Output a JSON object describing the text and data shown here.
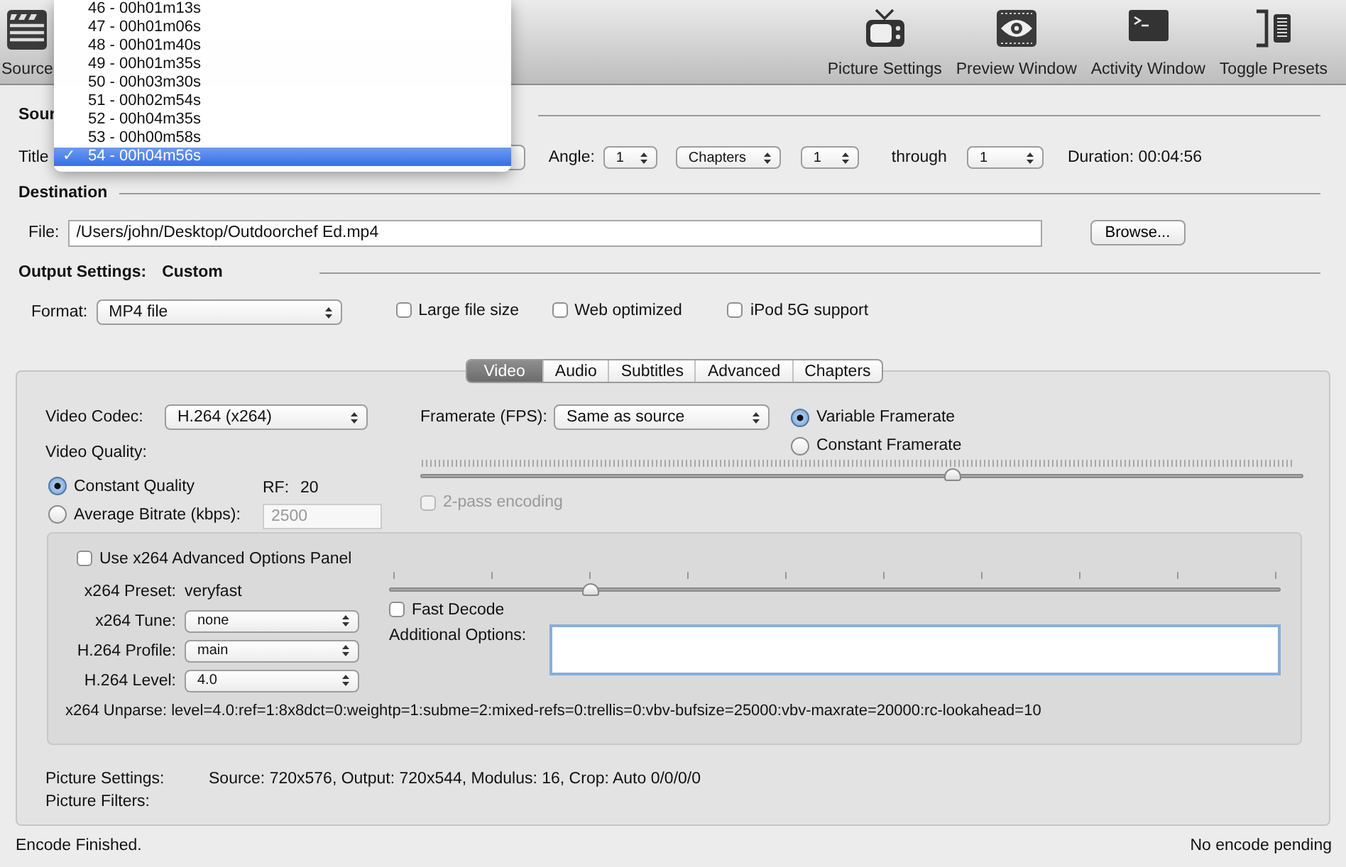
{
  "toolbar": {
    "left": [
      {
        "label": "Source",
        "kind": "clapper"
      }
    ],
    "right": [
      {
        "label": "Picture Settings",
        "kind": "tv"
      },
      {
        "label": "Preview Window",
        "kind": "eye"
      },
      {
        "label": "Activity Window",
        "kind": "terminal"
      },
      {
        "label": "Toggle Presets",
        "kind": "drawer"
      }
    ]
  },
  "title_menu": {
    "items": [
      {
        "label": "46 - 00h01m13s",
        "selected": false
      },
      {
        "label": "47 - 00h01m06s",
        "selected": false
      },
      {
        "label": "48 - 00h01m40s",
        "selected": false
      },
      {
        "label": "49 - 00h01m35s",
        "selected": false
      },
      {
        "label": "50 - 00h03m30s",
        "selected": false
      },
      {
        "label": "51 - 00h02m54s",
        "selected": false
      },
      {
        "label": "52 - 00h04m35s",
        "selected": false
      },
      {
        "label": "53 - 00h00m58s",
        "selected": false
      },
      {
        "label": "54 - 00h04m56s",
        "selected": true
      }
    ],
    "check": "✓"
  },
  "source": {
    "heading": "Sour"
  },
  "title_row": {
    "label": "Title",
    "angle_label": "Angle:",
    "angle": "1",
    "range_mode": "Chapters",
    "start": "1",
    "through": "through",
    "end": "1",
    "duration": "Duration: 00:04:56"
  },
  "destination": {
    "heading": "Destination",
    "file_label": "File:",
    "file": "/Users/john/Desktop/Outdoorchef Ed.mp4",
    "browse": "Browse..."
  },
  "output": {
    "heading": "Output Settings:",
    "preset": "Custom",
    "format_label": "Format:",
    "format": "MP4 file",
    "options": [
      {
        "label": "Large file size",
        "checked": false
      },
      {
        "label": "Web optimized",
        "checked": false
      },
      {
        "label": "iPod 5G support",
        "checked": false
      }
    ]
  },
  "tabs": [
    {
      "label": "Video",
      "selected": true
    },
    {
      "label": "Audio",
      "selected": false
    },
    {
      "label": "Subtitles",
      "selected": false
    },
    {
      "label": "Advanced",
      "selected": false
    },
    {
      "label": "Chapters",
      "selected": false
    }
  ],
  "video": {
    "codec_label": "Video Codec:",
    "codec": "H.264 (x264)",
    "framerate_label": "Framerate (FPS):",
    "framerate": "Same as source",
    "framerate_modes": [
      {
        "label": "Variable Framerate",
        "selected": true
      },
      {
        "label": "Constant Framerate",
        "selected": false
      }
    ],
    "quality_label": "Video Quality:",
    "quality_modes": [
      {
        "label": "Constant Quality",
        "selected": true
      },
      {
        "label": "Average Bitrate (kbps):",
        "selected": false
      }
    ],
    "rf_label": "RF:",
    "rf": "20",
    "bitrate": "2500",
    "bitrate_disabled": true,
    "quality_slider": {
      "level": 0.603
    },
    "two_pass": {
      "label": "2-pass encoding",
      "checked": false,
      "disabled": true
    }
  },
  "advanced": {
    "use_panel": {
      "label": "Use x264 Advanced Options Panel",
      "checked": false
    },
    "preset_label": "x264 Preset:",
    "preset": "veryfast",
    "preset_slider": {
      "level": 0.226
    },
    "popups": [
      {
        "label": "x264 Tune:",
        "value": "none"
      },
      {
        "label": "H.264 Profile:",
        "value": "main"
      },
      {
        "label": "H.264 Level:",
        "value": "4.0"
      }
    ],
    "fast_decode": {
      "label": "Fast Decode",
      "checked": false
    },
    "additional_label": "Additional Options:",
    "unparse": "x264 Unparse: level=4.0:ref=1:8x8dct=0:weightp=1:subme=2:mixed-refs=0:trellis=0:vbv-bufsize=25000:vbv-maxrate=20000:rc-lookahead=10"
  },
  "picture": [
    {
      "label": "Picture Settings:",
      "value": "Source: 720x576, Output: 720x544, Modulus: 16, Crop: Auto 0/0/0/0"
    },
    {
      "label": "Picture Filters:"
    }
  ],
  "status_bar": {
    "left": "Encode Finished.",
    "right": "No encode pending"
  }
}
